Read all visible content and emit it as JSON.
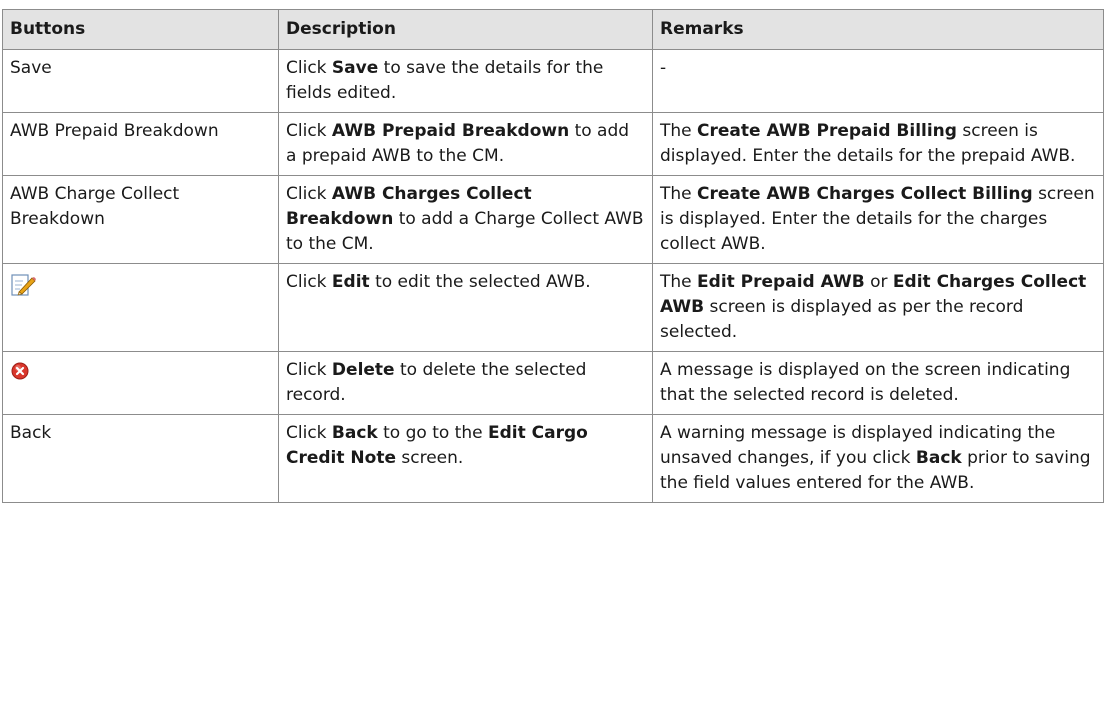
{
  "headers": [
    "Buttons",
    "Description",
    "Remarks"
  ],
  "rows": [
    {
      "button": "Save",
      "desc": [
        "Click ",
        "Save",
        " to save the details for the fields edited."
      ],
      "remarks": [
        "-"
      ]
    },
    {
      "button": "AWB Prepaid Breakdown",
      "desc": [
        "Click ",
        "AWB Prepaid Breakdown",
        " to add a prepaid AWB to the CM."
      ],
      "remarks": [
        "The ",
        "Create AWB Prepaid Billing",
        " screen is displayed. Enter the details for the prepaid AWB."
      ]
    },
    {
      "button": "AWB Charge Collect Breakdown",
      "desc": [
        "Click ",
        "AWB Charges Collect Breakdown",
        " to add a Charge Collect AWB to the CM."
      ],
      "remarks": [
        "The ",
        "Create AWB Charges Collect Billing",
        " screen is displayed. Enter the details for the charges collect AWB."
      ]
    },
    {
      "button_icon": "edit-pencil-icon",
      "desc": [
        "Click ",
        "Edit",
        " to edit the selected AWB."
      ],
      "remarks": [
        "The ",
        "Edit Prepaid AWB",
        " or ",
        "Edit Charges Collect AWB",
        " screen is displayed as per the record selected."
      ]
    },
    {
      "button_icon": "delete-x-icon",
      "desc": [
        "Click ",
        "Delete",
        " to delete the selected record."
      ],
      "remarks": [
        "A message is displayed on the screen indicating that the selected record is deleted."
      ]
    },
    {
      "button": "Back",
      "desc": [
        "Click ",
        "Back",
        " to go to the ",
        "Edit Cargo Credit Note",
        " screen."
      ],
      "remarks": [
        "A warning message is displayed indicating the unsaved changes, if you click ",
        "Back",
        " prior to saving the field values entered for the AWB."
      ]
    }
  ],
  "colors": {
    "header_bg": "#e3e3e3",
    "border": "#8c8c8c",
    "delete_icon": "#d9362b",
    "edit_icon_pencil": "#e8a317"
  }
}
